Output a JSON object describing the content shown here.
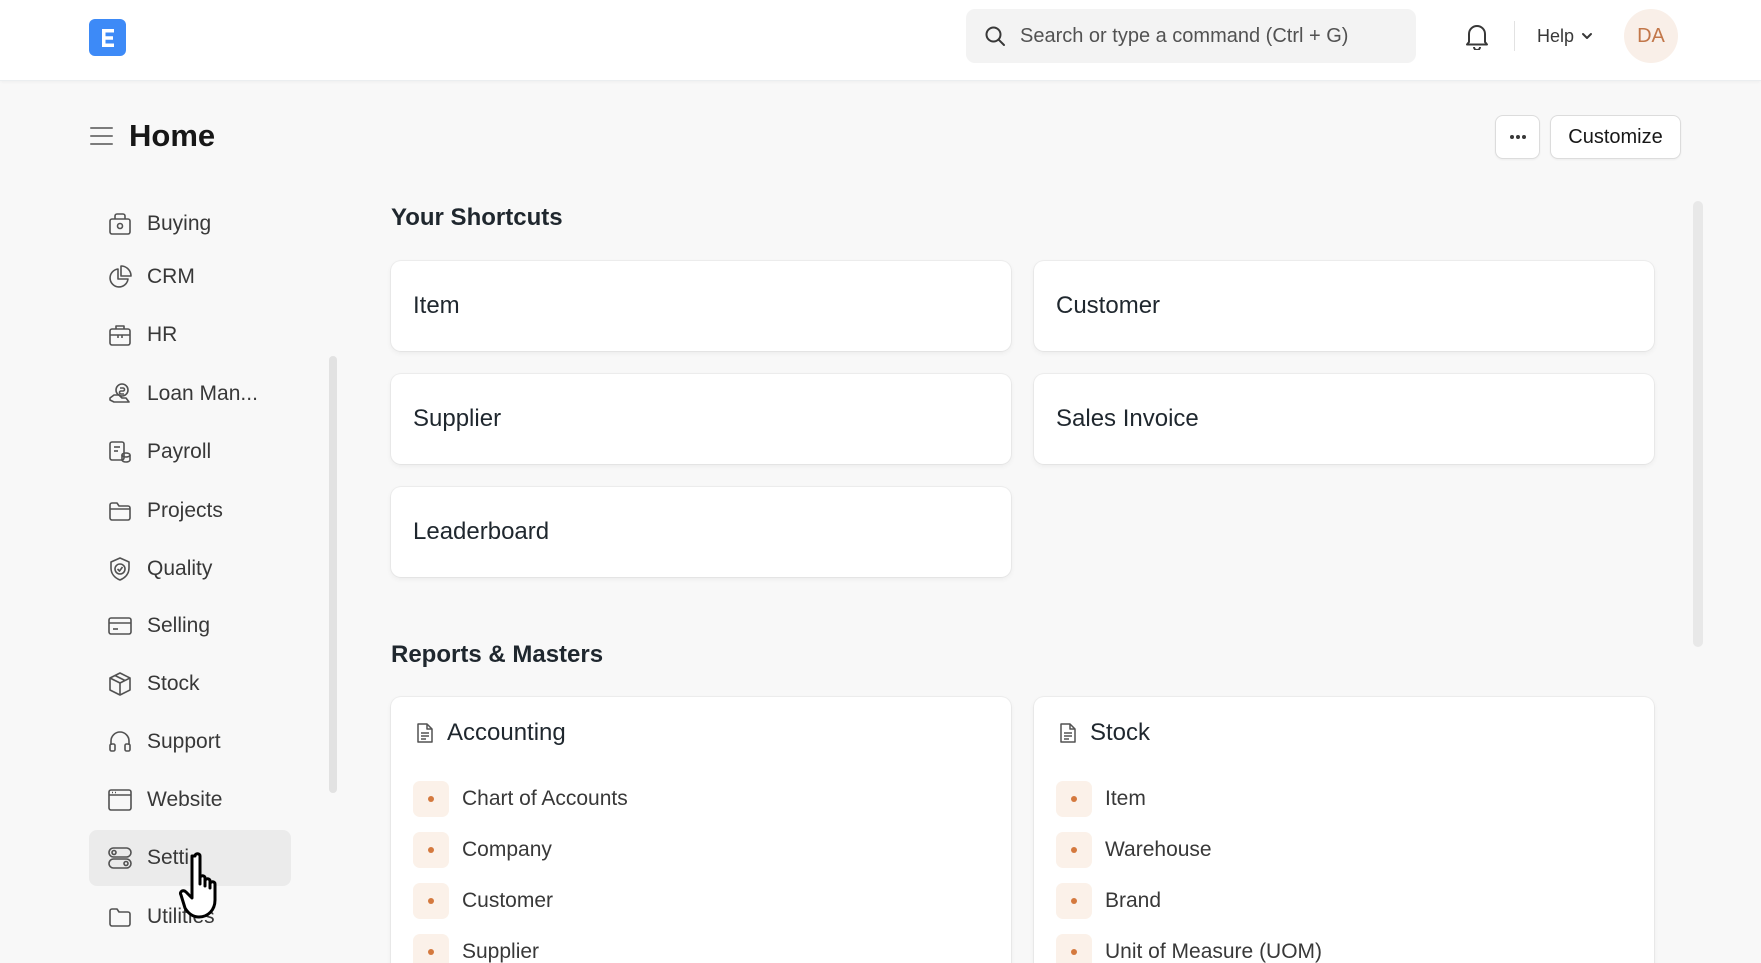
{
  "navbar": {
    "search_placeholder": "Search or type a command (Ctrl + G)",
    "help_label": "Help",
    "avatar_initials": "DA"
  },
  "page": {
    "title": "Home",
    "more_label": "···",
    "customize_label": "Customize"
  },
  "sidebar": {
    "items": [
      {
        "label": "Buying",
        "icon": "shopping-bag-icon"
      },
      {
        "label": "CRM",
        "icon": "pie-chart-icon"
      },
      {
        "label": "HR",
        "icon": "briefcase-icon"
      },
      {
        "label": "Loan Man...",
        "icon": "hand-coins-icon"
      },
      {
        "label": "Payroll",
        "icon": "payroll-icon"
      },
      {
        "label": "Projects",
        "icon": "folder-icon"
      },
      {
        "label": "Quality",
        "icon": "shield-check-icon"
      },
      {
        "label": "Selling",
        "icon": "credit-card-icon"
      },
      {
        "label": "Stock",
        "icon": "box-icon"
      },
      {
        "label": "Support",
        "icon": "headphones-icon"
      },
      {
        "label": "Website",
        "icon": "browser-icon"
      },
      {
        "label": "Setti",
        "icon": "toggle-settings-icon"
      },
      {
        "label": "Utilities",
        "icon": "folder-icon"
      }
    ]
  },
  "shortcuts": {
    "title": "Your Shortcuts",
    "items": [
      "Item",
      "Customer",
      "Supplier",
      "Sales Invoice",
      "Leaderboard"
    ]
  },
  "reports": {
    "title": "Reports & Masters",
    "cards": [
      {
        "title": "Accounting",
        "links": [
          "Chart of Accounts",
          "Company",
          "Customer",
          "Supplier"
        ]
      },
      {
        "title": "Stock",
        "links": [
          "Item",
          "Warehouse",
          "Brand",
          "Unit of Measure (UOM)"
        ]
      }
    ]
  },
  "colors": {
    "accent": "#3d8af7",
    "dot": "#d4793e",
    "avatar_bg": "#f9efe8"
  }
}
